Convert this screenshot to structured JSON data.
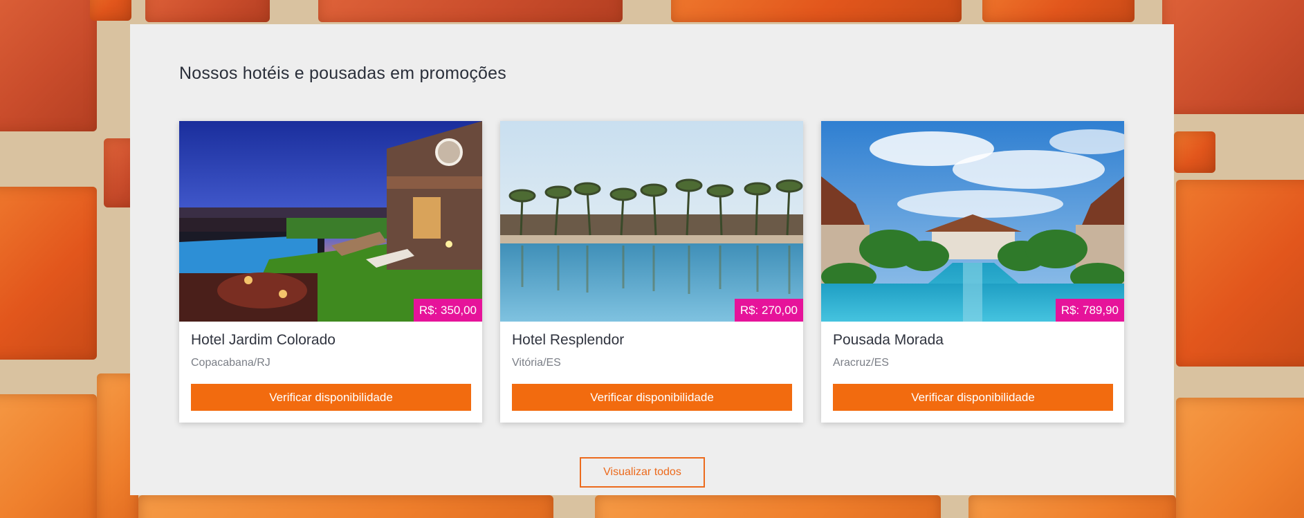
{
  "section": {
    "title": "Nossos hotéis e pousadas em promoções"
  },
  "hotels": [
    {
      "name": "Hotel Jardim Colorado",
      "location": "Copacabana/RJ",
      "price": "R$: 350,00",
      "button_label": "Verificar disponibilidade"
    },
    {
      "name": "Hotel Resplendor",
      "location": "Vitória/ES",
      "price": "R$: 270,00",
      "button_label": "Verificar disponibilidade"
    },
    {
      "name": "Pousada Morada",
      "location": "Aracruz/ES",
      "price": "R$: 789,90",
      "button_label": "Verificar disponibilidade"
    }
  ],
  "view_all_label": "Visualizar todos",
  "colors": {
    "accent": "#f26b0f",
    "price_badge": "#e6139a",
    "panel": "#eeeeee"
  },
  "icons": [
    "brick-wall-background",
    "hotel-photo"
  ]
}
